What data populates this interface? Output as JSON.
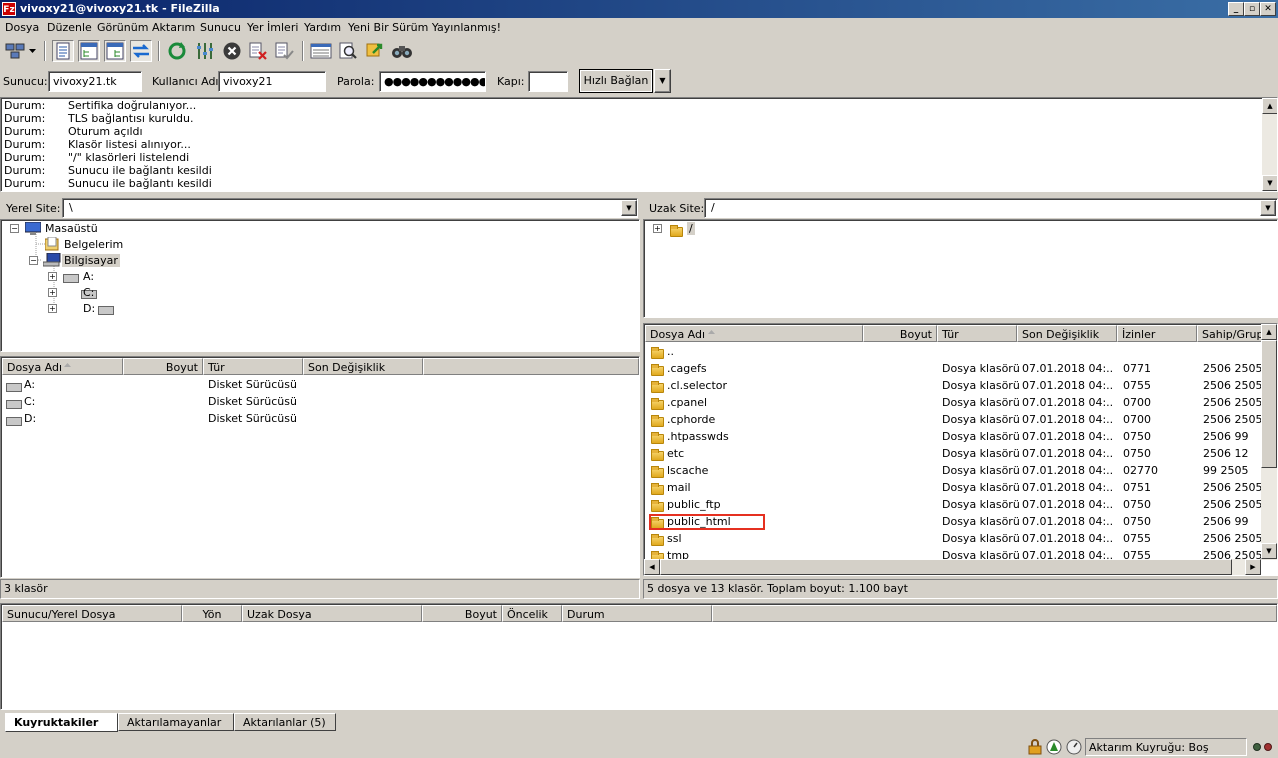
{
  "window": {
    "title": "vivoxy21@vivoxy21.tk - FileZilla",
    "app_glyph": "Fz",
    "min": "_",
    "max": "▫",
    "close": "✕"
  },
  "menu": [
    "Dosya",
    "Düzenle",
    "Görünüm",
    "Aktarım",
    "Sunucu",
    "Yer İmleri",
    "Yardım",
    "Yeni Bir Sürüm Yayınlanmış!"
  ],
  "toolbar": [
    "site-manager",
    "toggle-log",
    "toggle-local-tree",
    "toggle-remote-tree",
    "toggle-queue",
    "refresh",
    "process-queue",
    "cancel",
    "disconnect",
    "reconnect",
    "filename-filters",
    "compare",
    "sync-browse",
    "search"
  ],
  "quickconnect": {
    "host_label": "Sunucu:",
    "host": "vivoxy21.tk",
    "user_label": "Kullanıcı Adı:",
    "user": "vivoxy21",
    "pass_label": "Parola:",
    "pass": "●●●●●●●●●●●●",
    "port_label": "Kapı:",
    "port": "",
    "button": "Hızlı Bağlan",
    "dropdown": "▼"
  },
  "log": [
    {
      "k": "Durum:",
      "v": "Sertifika doğrulanıyor..."
    },
    {
      "k": "Durum:",
      "v": "TLS bağlantısı kuruldu."
    },
    {
      "k": "Durum:",
      "v": "Oturum açıldı"
    },
    {
      "k": "Durum:",
      "v": "Klasör listesi alınıyor..."
    },
    {
      "k": "Durum:",
      "v": "\"/\" klasörleri listelendi"
    },
    {
      "k": "Durum:",
      "v": "Sunucu ile bağlantı kesildi"
    },
    {
      "k": "Durum:",
      "v": "Sunucu ile bağlantı kesildi"
    }
  ],
  "local": {
    "site_label": "Yerel Site:",
    "site_path": "\\",
    "tree": [
      {
        "label": "Masaüstü",
        "exp": "−"
      },
      {
        "label": "Belgelerim",
        "exp": ""
      },
      {
        "label": "Bilgisayar",
        "exp": "−"
      },
      {
        "label": "A:",
        "exp": "+"
      },
      {
        "label": "C:",
        "exp": "+"
      },
      {
        "label": "D:",
        "exp": "+"
      }
    ],
    "columns": [
      "Dosya Adı",
      "Boyut",
      "Tür",
      "Son Değişiklik"
    ],
    "files": [
      {
        "name": "A:",
        "type": "Disket Sürücüsü"
      },
      {
        "name": "C:",
        "type": "Disket Sürücüsü"
      },
      {
        "name": "D:",
        "type": "Disket Sürücüsü"
      }
    ],
    "status": "3 klasör"
  },
  "remote": {
    "site_label": "Uzak Site:",
    "site_path": "/",
    "tree_root": "/",
    "tree_exp": "+",
    "columns": [
      "Dosya Adı",
      "Boyut",
      "Tür",
      "Son Değişiklik",
      "İzinler",
      "Sahip/Grup"
    ],
    "files": [
      {
        "name": "..",
        "type": "",
        "date": "",
        "perm": "",
        "owner": ""
      },
      {
        "name": ".cagefs",
        "type": "Dosya klasörü",
        "date": "07.01.2018 04:...",
        "perm": "0771",
        "owner": "2506 2505"
      },
      {
        "name": ".cl.selector",
        "type": "Dosya klasörü",
        "date": "07.01.2018 04:...",
        "perm": "0755",
        "owner": "2506 2505"
      },
      {
        "name": ".cpanel",
        "type": "Dosya klasörü",
        "date": "07.01.2018 04:...",
        "perm": "0700",
        "owner": "2506 2505"
      },
      {
        "name": ".cphorde",
        "type": "Dosya klasörü",
        "date": "07.01.2018 04:...",
        "perm": "0700",
        "owner": "2506 2505"
      },
      {
        "name": ".htpasswds",
        "type": "Dosya klasörü",
        "date": "07.01.2018 04:...",
        "perm": "0750",
        "owner": "2506 99"
      },
      {
        "name": "etc",
        "type": "Dosya klasörü",
        "date": "07.01.2018 04:...",
        "perm": "0750",
        "owner": "2506 12"
      },
      {
        "name": "lscache",
        "type": "Dosya klasörü",
        "date": "07.01.2018 04:...",
        "perm": "02770",
        "owner": "99 2505"
      },
      {
        "name": "mail",
        "type": "Dosya klasörü",
        "date": "07.01.2018 04:...",
        "perm": "0751",
        "owner": "2506 2505"
      },
      {
        "name": "public_ftp",
        "type": "Dosya klasörü",
        "date": "07.01.2018 04:...",
        "perm": "0750",
        "owner": "2506 2505"
      },
      {
        "name": "public_html",
        "type": "Dosya klasörü",
        "date": "07.01.2018 04:...",
        "perm": "0750",
        "owner": "2506 99"
      },
      {
        "name": "ssl",
        "type": "Dosya klasörü",
        "date": "07.01.2018 04:...",
        "perm": "0755",
        "owner": "2506 2505"
      },
      {
        "name": "tmp",
        "type": "Dosya klasörü",
        "date": "07.01.2018 04:...",
        "perm": "0755",
        "owner": "2506 2505"
      }
    ],
    "highlighted": "public_html",
    "status": "5 dosya ve 13 klasör. Toplam boyut: 1.100 bayt"
  },
  "queue": {
    "columns": [
      "Sunucu/Yerel Dosya",
      "Yön",
      "Uzak Dosya",
      "Boyut",
      "Öncelik",
      "Durum"
    ],
    "tabs": [
      "Kuyruktakiler",
      "Aktarılamayanlar",
      "Aktarılanlar (5)"
    ]
  },
  "statusbar": {
    "queue": "Aktarım Kuyruğu: Boş"
  },
  "colors": {
    "title_start": "#0a246a",
    "title_end": "#3a6ea5",
    "highlight_box": "#e53020",
    "folder": "#f0c040"
  }
}
